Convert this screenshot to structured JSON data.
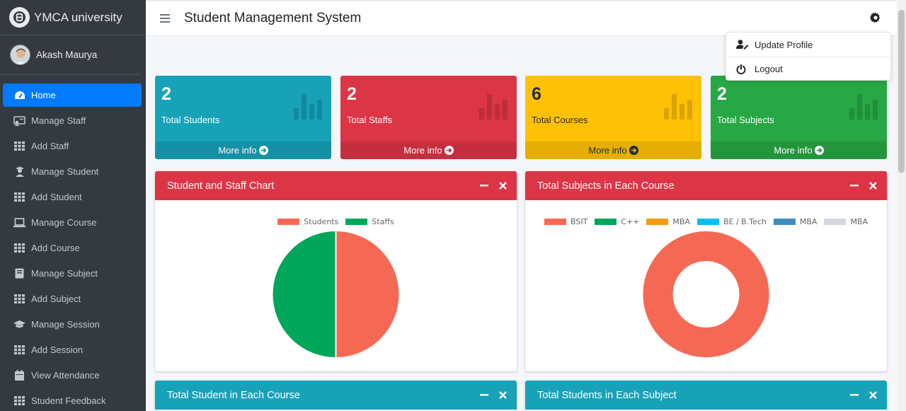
{
  "brand": {
    "name": "YMCA university"
  },
  "user": {
    "name": "Akash Maurya"
  },
  "sidebar": {
    "items": [
      {
        "label": "Home",
        "icon": "dashboard-icon",
        "active": true
      },
      {
        "label": "Manage Staff",
        "icon": "staff-icon"
      },
      {
        "label": "Add Staff",
        "icon": "grid-icon"
      },
      {
        "label": "Manage Student",
        "icon": "student-icon"
      },
      {
        "label": "Add Student",
        "icon": "grid-icon"
      },
      {
        "label": "Manage Course",
        "icon": "laptop-icon"
      },
      {
        "label": "Add Course",
        "icon": "grid-icon"
      },
      {
        "label": "Manage Subject",
        "icon": "book-icon"
      },
      {
        "label": "Add Subject",
        "icon": "grid-icon"
      },
      {
        "label": "Manage Session",
        "icon": "graduation-cap-icon"
      },
      {
        "label": "Add Session",
        "icon": "grid-icon"
      },
      {
        "label": "View Attendance",
        "icon": "calendar-icon"
      },
      {
        "label": "Student Feedback",
        "icon": "grid-icon"
      }
    ]
  },
  "header": {
    "title": "Student Management System"
  },
  "dropdown": {
    "update_profile": "Update Profile",
    "logout": "Logout"
  },
  "stats": [
    {
      "value": "2",
      "label": "Total Students",
      "footer": "More info",
      "color": "#17a2b8"
    },
    {
      "value": "2",
      "label": "Total Staffs",
      "footer": "More info",
      "color": "#dc3545"
    },
    {
      "value": "6",
      "label": "Total Courses",
      "footer": "More info",
      "color": "#ffc107"
    },
    {
      "value": "2",
      "label": "Total Subjects",
      "footer": "More info",
      "color": "#28a745"
    }
  ],
  "cards": {
    "student_staff": {
      "title": "Student and Staff Chart"
    },
    "subjects_course": {
      "title": "Total Subjects in Each Course"
    },
    "student_course": {
      "title": "Total Student in Each Course"
    },
    "students_subject": {
      "title": "Total Students in Each Subject"
    }
  },
  "chart_data": [
    {
      "type": "pie",
      "title": "Student and Staff Chart",
      "categories": [
        "Students",
        "Staffs"
      ],
      "values": [
        2,
        2
      ],
      "colors": [
        "#f56954",
        "#00a65a"
      ],
      "legend": "top"
    },
    {
      "type": "pie",
      "variant": "doughnut",
      "title": "Total Subjects in Each Course",
      "categories": [
        "BSIT",
        "C++",
        "MBA",
        "BE / B.Tech",
        "MBA",
        "MBA"
      ],
      "values": [
        2,
        0,
        0,
        0,
        0,
        0
      ],
      "colors": [
        "#f56954",
        "#00a65a",
        "#f39c12",
        "#00c0ef",
        "#3c8dbc",
        "#d2d6de"
      ],
      "legend": "top"
    }
  ]
}
